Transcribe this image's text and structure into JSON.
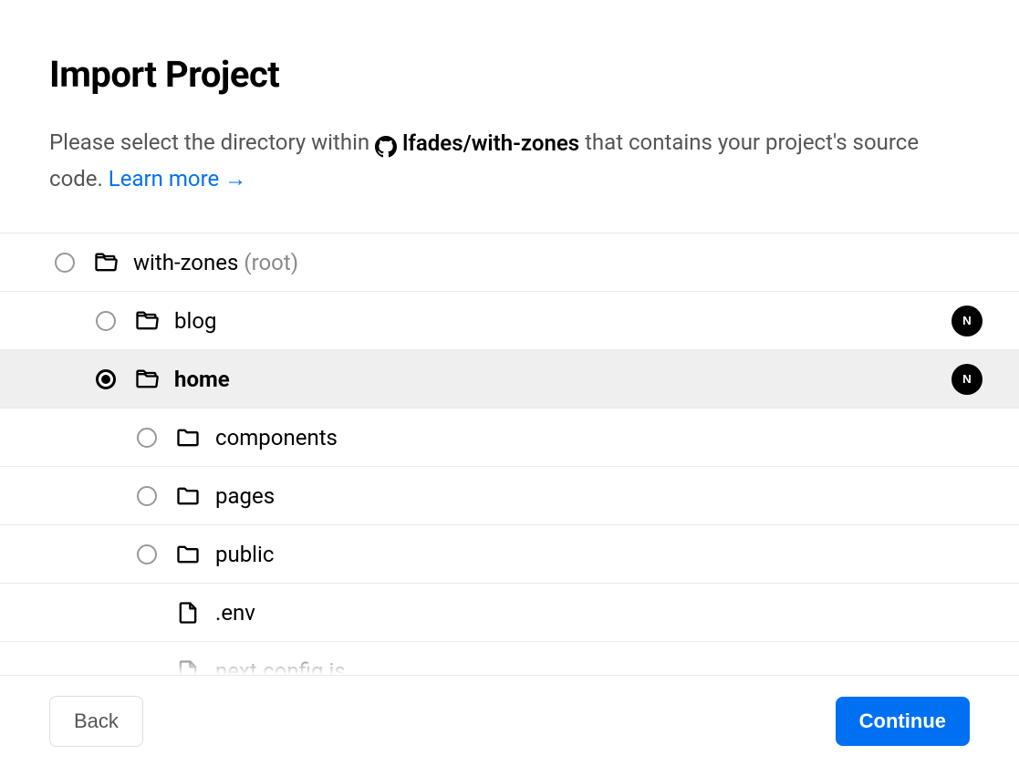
{
  "header": {
    "title": "Import Project",
    "description_prefix": "Please select the directory within",
    "repo": "lfades/with-zones",
    "description_suffix": "that contains your project's source code.",
    "learn_more": "Learn more →"
  },
  "tree": [
    {
      "type": "folder-open",
      "label": "with-zones",
      "suffix": "(root)",
      "level": 0,
      "selectable": true,
      "selected": false,
      "badge": null
    },
    {
      "type": "folder-open",
      "label": "blog",
      "suffix": "",
      "level": 1,
      "selectable": true,
      "selected": false,
      "badge": "next"
    },
    {
      "type": "folder-open",
      "label": "home",
      "suffix": "",
      "level": 1,
      "selectable": true,
      "selected": true,
      "badge": "next"
    },
    {
      "type": "folder",
      "label": "components",
      "suffix": "",
      "level": 2,
      "selectable": true,
      "selected": false,
      "badge": null
    },
    {
      "type": "folder",
      "label": "pages",
      "suffix": "",
      "level": 2,
      "selectable": true,
      "selected": false,
      "badge": null
    },
    {
      "type": "folder",
      "label": "public",
      "suffix": "",
      "level": 2,
      "selectable": true,
      "selected": false,
      "badge": null
    },
    {
      "type": "file",
      "label": ".env",
      "suffix": "",
      "level": 2,
      "selectable": false,
      "selected": false,
      "badge": null
    },
    {
      "type": "file",
      "label": "next.config.js",
      "suffix": "",
      "level": 2,
      "selectable": false,
      "selected": false,
      "badge": null
    }
  ],
  "footer": {
    "back": "Back",
    "continue": "Continue"
  },
  "colors": {
    "accent": "#0070f3"
  }
}
